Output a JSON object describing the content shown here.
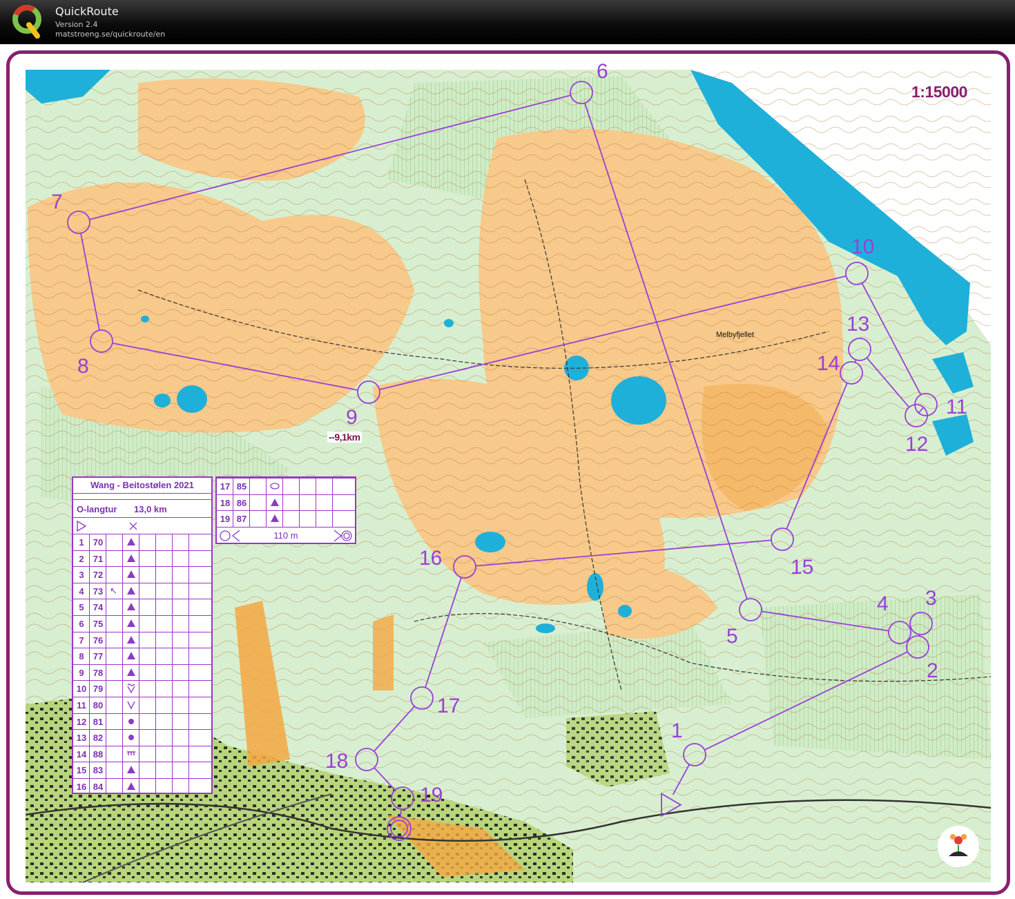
{
  "app": {
    "title": "QuickRoute",
    "version": "Version 2.4",
    "url": "matstroeng.se/quickroute/en"
  },
  "map": {
    "scale": "1:15000",
    "distance_label": "--9,1km",
    "place_name": "Melbyfjellet",
    "course_color": "#9b3fd6",
    "frame_color": "#8a1f6e",
    "water_color": "#1fb0da",
    "open_land_color": "#f7c98a",
    "forest_color": "#ffffff",
    "green_color": "#8fcf7a",
    "controls": [
      {
        "label": "1"
      },
      {
        "label": "2"
      },
      {
        "label": "3"
      },
      {
        "label": "4"
      },
      {
        "label": "5"
      },
      {
        "label": "6"
      },
      {
        "label": "7"
      },
      {
        "label": "8"
      },
      {
        "label": "9"
      },
      {
        "label": "10"
      },
      {
        "label": "11"
      },
      {
        "label": "12"
      },
      {
        "label": "13"
      },
      {
        "label": "14"
      },
      {
        "label": "15"
      },
      {
        "label": "16"
      },
      {
        "label": "17"
      },
      {
        "label": "18"
      },
      {
        "label": "19"
      }
    ]
  },
  "control_description": {
    "event": "Wang - Beitostølen 2021",
    "class": "O-langtur",
    "length": "13,0 km",
    "rows": [
      {
        "n": "1",
        "code": "70",
        "sym": "triangle"
      },
      {
        "n": "2",
        "code": "71",
        "sym": "triangle"
      },
      {
        "n": "3",
        "code": "72",
        "sym": "triangle"
      },
      {
        "n": "4",
        "code": "73",
        "sym": "triangle",
        "dir": "↖"
      },
      {
        "n": "5",
        "code": "74",
        "sym": "triangle"
      },
      {
        "n": "6",
        "code": "75",
        "sym": "triangle"
      },
      {
        "n": "7",
        "code": "76",
        "sym": "triangle"
      },
      {
        "n": "8",
        "code": "77",
        "sym": "triangle"
      },
      {
        "n": "9",
        "code": "78",
        "sym": "triangle"
      },
      {
        "n": "10",
        "code": "79",
        "sym": "reentrant-top"
      },
      {
        "n": "11",
        "code": "80",
        "sym": "reentrant"
      },
      {
        "n": "12",
        "code": "81",
        "sym": "dot"
      },
      {
        "n": "13",
        "code": "82",
        "sym": "dot"
      },
      {
        "n": "14",
        "code": "88",
        "sym": "wall"
      },
      {
        "n": "15",
        "code": "83",
        "sym": "triangle"
      },
      {
        "n": "16",
        "code": "84",
        "sym": "triangle"
      },
      {
        "n": "17",
        "code": "85",
        "sym": "ellipse"
      },
      {
        "n": "18",
        "code": "86",
        "sym": "triangle"
      },
      {
        "n": "19",
        "code": "87",
        "sym": "triangle"
      }
    ],
    "finish_distance": "110 m"
  }
}
